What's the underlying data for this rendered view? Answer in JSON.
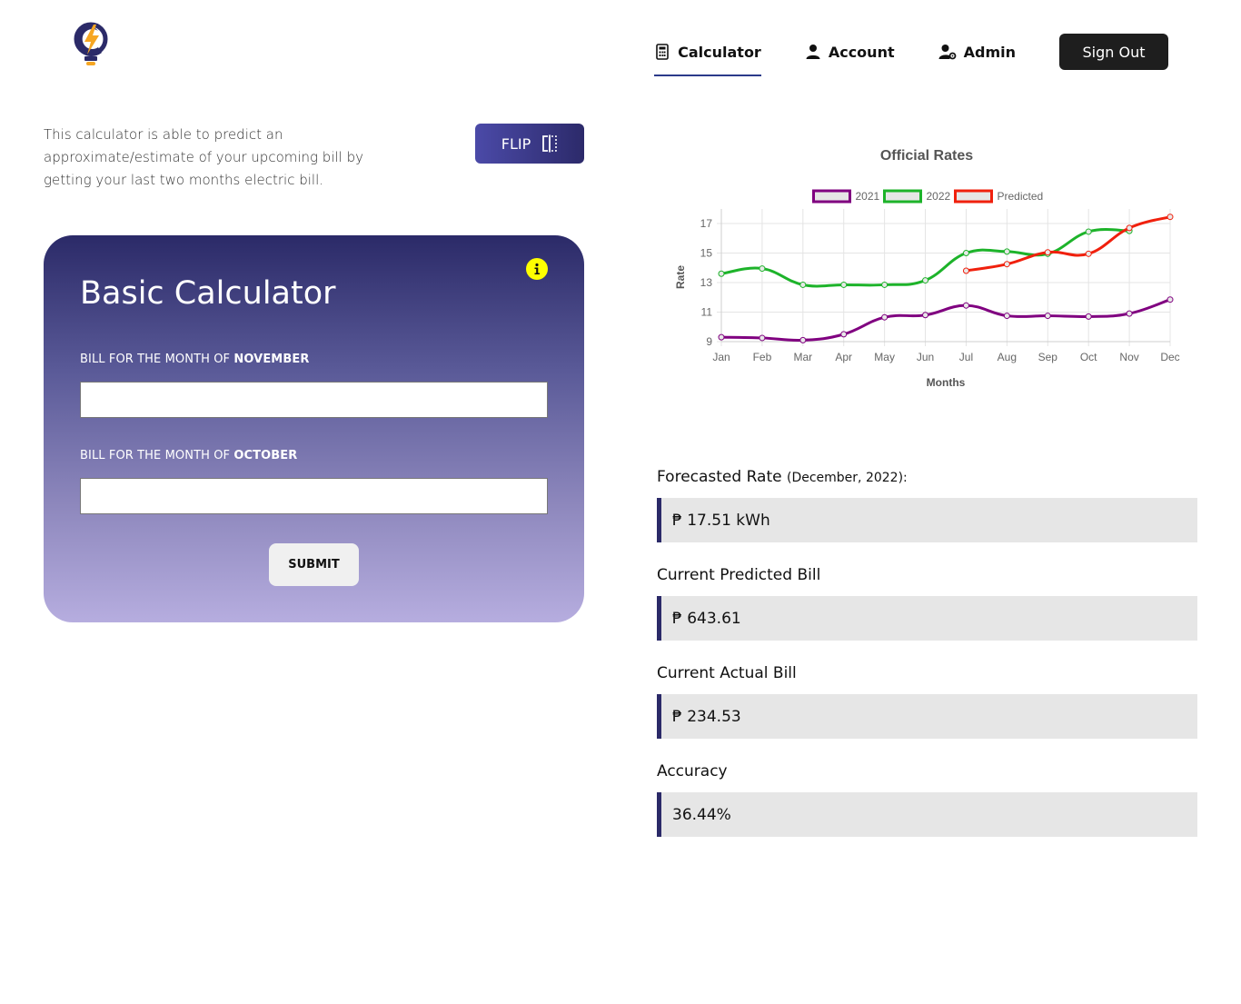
{
  "nav": {
    "calculator": "Calculator",
    "account": "Account",
    "admin": "Admin",
    "sign_out": "Sign Out",
    "icons": [
      "calculator-icon",
      "user-icon",
      "user-gear-icon"
    ]
  },
  "intro": {
    "text": "This calculator is able to predict an approximate/estimate of your upcoming bill by getting your last two months electric bill.",
    "flip_label": "FLIP"
  },
  "calculator": {
    "title": "Basic Calculator",
    "field1_prefix": "BILL FOR THE MONTH OF ",
    "field1_month": "NOVEMBER",
    "field1_value": "",
    "field2_prefix": "BILL FOR THE MONTH OF ",
    "field2_month": "OCTOBER",
    "field2_value": "",
    "submit_label": "SUBMIT"
  },
  "results": {
    "forecast_label": "Forecasted Rate",
    "forecast_sub": "(December, 2022):",
    "forecast_value": "₱ 17.51 kWh",
    "predicted_label": "Current Predicted Bill",
    "predicted_value": "₱ 643.61",
    "actual_label": "Current Actual Bill",
    "actual_value": "₱ 234.53",
    "accuracy_label": "Accuracy",
    "accuracy_value": "36.44%"
  },
  "chart_data": {
    "type": "line",
    "title": "Official Rates",
    "xlabel": "Months",
    "ylabel": "Rate",
    "categories": [
      "Jan",
      "Feb",
      "Mar",
      "Apr",
      "May",
      "Jun",
      "Jul",
      "Aug",
      "Sep",
      "Oct",
      "Nov",
      "Dec"
    ],
    "yticks": [
      9,
      11,
      13,
      15,
      17
    ],
    "ylim": [
      9,
      17.8
    ],
    "grid": true,
    "legend": "top",
    "series": [
      {
        "name": "2021",
        "color": "#800080",
        "values": [
          9.3,
          9.25,
          9.1,
          9.5,
          10.65,
          10.8,
          11.45,
          10.75,
          10.75,
          10.7,
          10.9,
          11.85
        ]
      },
      {
        "name": "2022",
        "color": "#1db32a",
        "values": [
          13.6,
          13.95,
          12.85,
          12.85,
          12.85,
          13.15,
          15.0,
          15.1,
          14.95,
          16.45,
          16.5,
          null
        ]
      },
      {
        "name": "Predicted",
        "color": "#f0200d",
        "values": [
          null,
          null,
          null,
          null,
          null,
          null,
          13.8,
          14.25,
          15.05,
          14.95,
          16.7,
          17.45
        ]
      }
    ]
  }
}
